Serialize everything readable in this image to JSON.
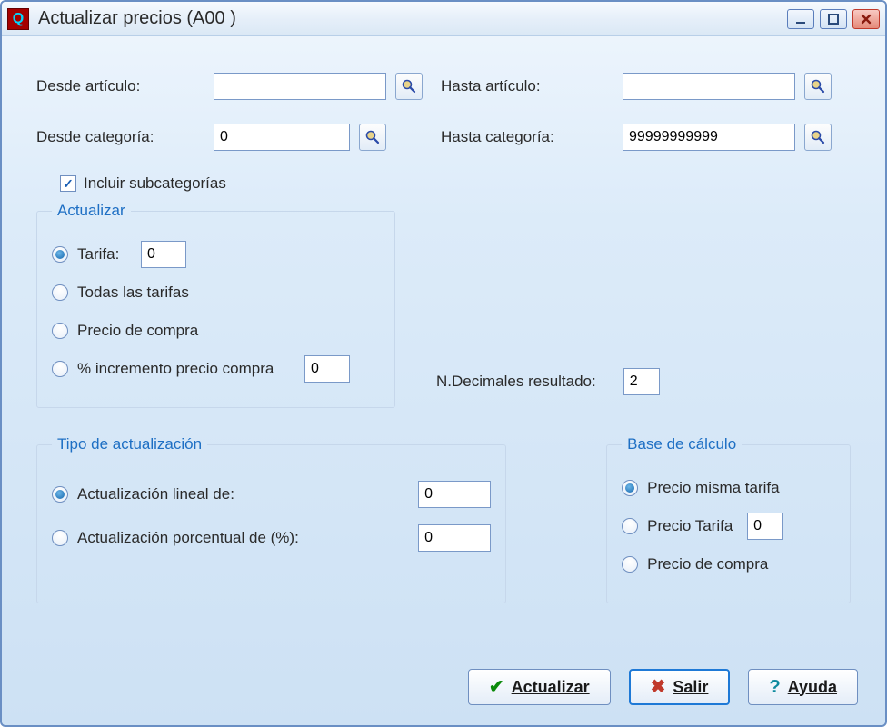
{
  "window": {
    "title": "Actualizar precios (A00 )"
  },
  "filters": {
    "desde_articulo_label": "Desde artículo:",
    "desde_articulo_value": "",
    "hasta_articulo_label": "Hasta artículo:",
    "hasta_articulo_value": "",
    "desde_categoria_label": "Desde categoría:",
    "desde_categoria_value": "0",
    "hasta_categoria_label": "Hasta categoría:",
    "hasta_categoria_value": "99999999999",
    "incluir_subcategorias_label": "Incluir subcategorías",
    "incluir_subcategorias_checked": true
  },
  "actualizar": {
    "legend": "Actualizar",
    "tarifa_label": "Tarifa:",
    "tarifa_value": "0",
    "todas_label": "Todas las tarifas",
    "precio_compra_label": "Precio de compra",
    "incremento_label": "% incremento precio compra",
    "incremento_value": "0",
    "selected": "tarifa"
  },
  "decimales": {
    "label": "N.Decimales resultado:",
    "value": "2"
  },
  "tipo": {
    "legend": "Tipo de actualización",
    "lineal_label": "Actualización lineal de:",
    "lineal_value": "0",
    "porcentual_label": "Actualización porcentual de (%):",
    "porcentual_value": "0",
    "selected": "lineal"
  },
  "base": {
    "legend": "Base de cálculo",
    "misma_label": "Precio misma tarifa",
    "tarifa_label": "Precio Tarifa",
    "tarifa_value": "0",
    "compra_label": "Precio de compra",
    "selected": "misma"
  },
  "buttons": {
    "actualizar": "Actualizar",
    "salir": "Salir",
    "ayuda": "Ayuda"
  }
}
